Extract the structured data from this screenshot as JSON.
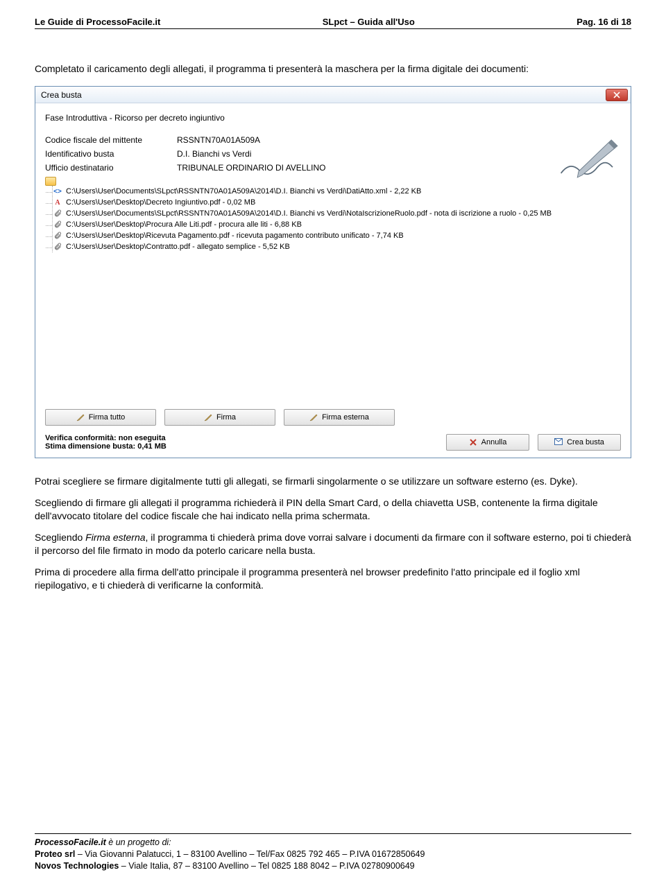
{
  "header": {
    "left": "Le Guide di ProcessoFacile.it",
    "center": "SLpct – Guida all'Uso",
    "right": "Pag. 16 di 18"
  },
  "intro": "Completato il caricamento degli allegati, il programma ti presenterà la maschera per la firma digitale dei documenti:",
  "window": {
    "title": "Crea busta",
    "fase": "Fase Introduttiva - Ricorso per decreto ingiuntivo",
    "fields": {
      "codice_label": "Codice fiscale del mittente",
      "codice_value": "RSSNTN70A01A509A",
      "ident_label": "Identificativo busta",
      "ident_value": "D.I. Bianchi vs Verdi",
      "ufficio_label": "Ufficio destinatario",
      "ufficio_value": "TRIBUNALE ORDINARIO DI AVELLINO"
    },
    "tree": [
      {
        "icon": "xml",
        "text": "C:\\Users\\User\\Documents\\SLpct\\RSSNTN70A01A509A\\2014\\D.I. Bianchi vs Verdi\\DatiAtto.xml - 2,22 KB"
      },
      {
        "icon": "a",
        "text": "C:\\Users\\User\\Desktop\\Decreto Ingiuntivo.pdf - 0,02 MB"
      },
      {
        "icon": "clip",
        "text": "C:\\Users\\User\\Documents\\SLpct\\RSSNTN70A01A509A\\2014\\D.I. Bianchi vs Verdi\\NotaIscrizioneRuolo.pdf - nota di iscrizione a ruolo - 0,25 MB"
      },
      {
        "icon": "clip",
        "text": "C:\\Users\\User\\Desktop\\Procura Alle Liti.pdf - procura alle liti - 6,88 KB"
      },
      {
        "icon": "clip",
        "text": "C:\\Users\\User\\Desktop\\Ricevuta Pagamento.pdf - ricevuta pagamento contributo unificato - 7,74 KB"
      },
      {
        "icon": "clip",
        "text": "C:\\Users\\User\\Desktop\\Contratto.pdf - allegato semplice - 5,52 KB"
      }
    ],
    "buttons": {
      "firma_tutto": "Firma tutto",
      "firma": "Firma",
      "firma_esterna": "Firma esterna",
      "annulla": "Annulla",
      "crea_busta": "Crea busta"
    },
    "status": {
      "verifica": "Verifica conformità: non eseguita",
      "stima": "Stima dimensione busta: 0,41 MB"
    }
  },
  "paragraphs": {
    "p1": "Potrai scegliere se firmare digitalmente tutti gli allegati, se firmarli singolarmente o se utilizzare un software esterno (es. Dyke).",
    "p2": "Scegliendo di firmare gli allegati il programma richiederà il PIN della Smart Card, o della chiavetta USB, contenente la firma digitale dell'avvocato titolare del codice fiscale che hai indicato nella prima schermata.",
    "p3_pre": "Scegliendo ",
    "p3_em": "Firma esterna",
    "p3_post": ", il programma ti chiederà prima dove vorrai salvare i documenti da firmare con il software esterno, poi ti chiederà il percorso del file firmato in modo da poterlo caricare nella busta.",
    "p4": "Prima di procedere alla firma dell'atto principale il programma presenterà nel browser predefinito l'atto principale ed il foglio xml riepilogativo, e ti chiederà di verificarne la conformità."
  },
  "footer": {
    "line1_pre": "ProcessoFacile.it",
    "line1_post": " è un progetto di:",
    "line2_b": "Proteo srl",
    "line2_rest": " – Via Giovanni Palatucci, 1 – 83100 Avellino – Tel/Fax 0825 792 465 – P.IVA 01672850649",
    "line3_b": "Novos Technologies",
    "line3_rest": " – Viale Italia, 87 – 83100 Avellino – Tel 0825 188 8042 – P.IVA 02780900649"
  }
}
